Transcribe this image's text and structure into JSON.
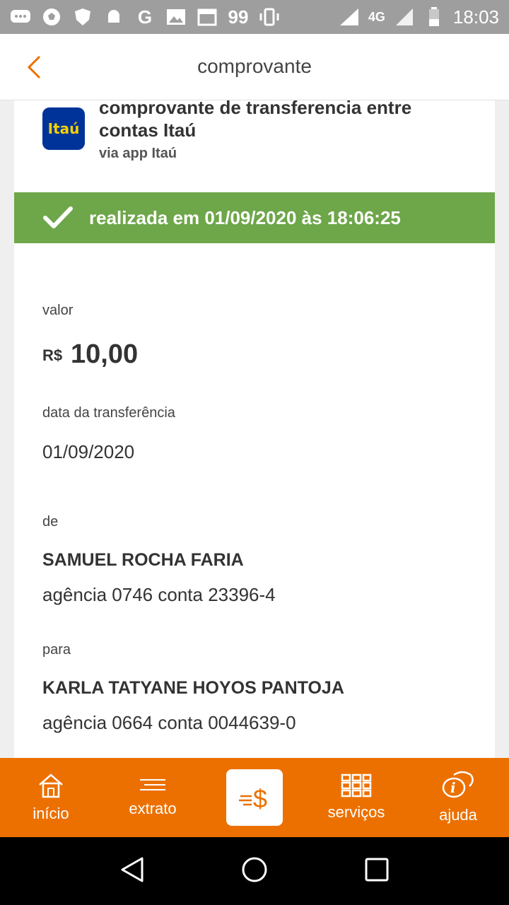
{
  "status_bar": {
    "time": "18:03",
    "network": "4G",
    "badge": "99",
    "g_letter": "G"
  },
  "header": {
    "title": "comprovante"
  },
  "receipt": {
    "bank_logo_text": "Itaú",
    "title": "comprovante de transferencia entre contas Itaú",
    "subtitle": "via app Itaú",
    "status_text": "realizada em 01/09/2020 às 18:06:25",
    "value_label": "valor",
    "currency": "R$",
    "amount": "10,00",
    "date_label": "data da transferência",
    "date_value": "01/09/2020",
    "from_label": "de",
    "from_name": "SAMUEL ROCHA FARIA",
    "from_account": "agência 0746 conta 23396-4",
    "to_label": "para",
    "to_name": "KARLA TATYANE HOYOS PANTOJA",
    "to_account": "agência 0664 conta 0044639-0"
  },
  "bottom_nav": {
    "home": "início",
    "statement": "extrato",
    "services": "serviços",
    "help": "ajuda"
  },
  "colors": {
    "brand_orange": "#ec7000",
    "success_green": "#6ea64a",
    "itau_blue": "#003399",
    "itau_yellow": "#f7d100"
  }
}
